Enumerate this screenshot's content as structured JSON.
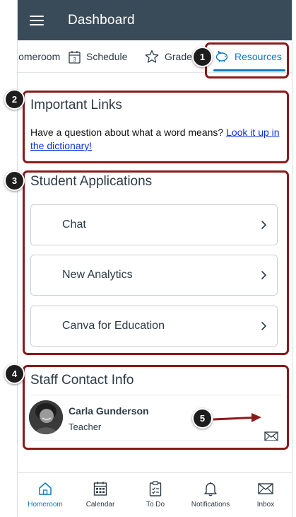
{
  "appbar": {
    "title": "Dashboard"
  },
  "tabs": {
    "homeroom": "Homeroom",
    "schedule": "Schedule",
    "schedule_icon_number": "3",
    "grades": "Grades",
    "resources": "Resources"
  },
  "important_links": {
    "title": "Important Links",
    "text": "Have a question about what a word means? ",
    "link": "Look it up in the dictionary!"
  },
  "student_applications": {
    "title": "Student Applications",
    "items": [
      {
        "label": "Chat"
      },
      {
        "label": "New Analytics"
      },
      {
        "label": "Canva for Education"
      }
    ]
  },
  "staff": {
    "title": "Staff Contact Info",
    "name": "Carla Gunderson",
    "role": "Teacher"
  },
  "bottom_nav": {
    "items": [
      {
        "label": "Homeroom",
        "icon": "home-icon"
      },
      {
        "label": "Calendar",
        "icon": "calendar-icon"
      },
      {
        "label": "To Do",
        "icon": "clipboard-icon"
      },
      {
        "label": "Notifications",
        "icon": "bell-icon"
      },
      {
        "label": "Inbox",
        "icon": "mail-icon"
      }
    ]
  },
  "callouts": [
    "1",
    "2",
    "3",
    "4",
    "5"
  ],
  "colors": {
    "header": "#394b58",
    "accent": "#0b7bc0",
    "highlight": "#8b1a1a"
  }
}
